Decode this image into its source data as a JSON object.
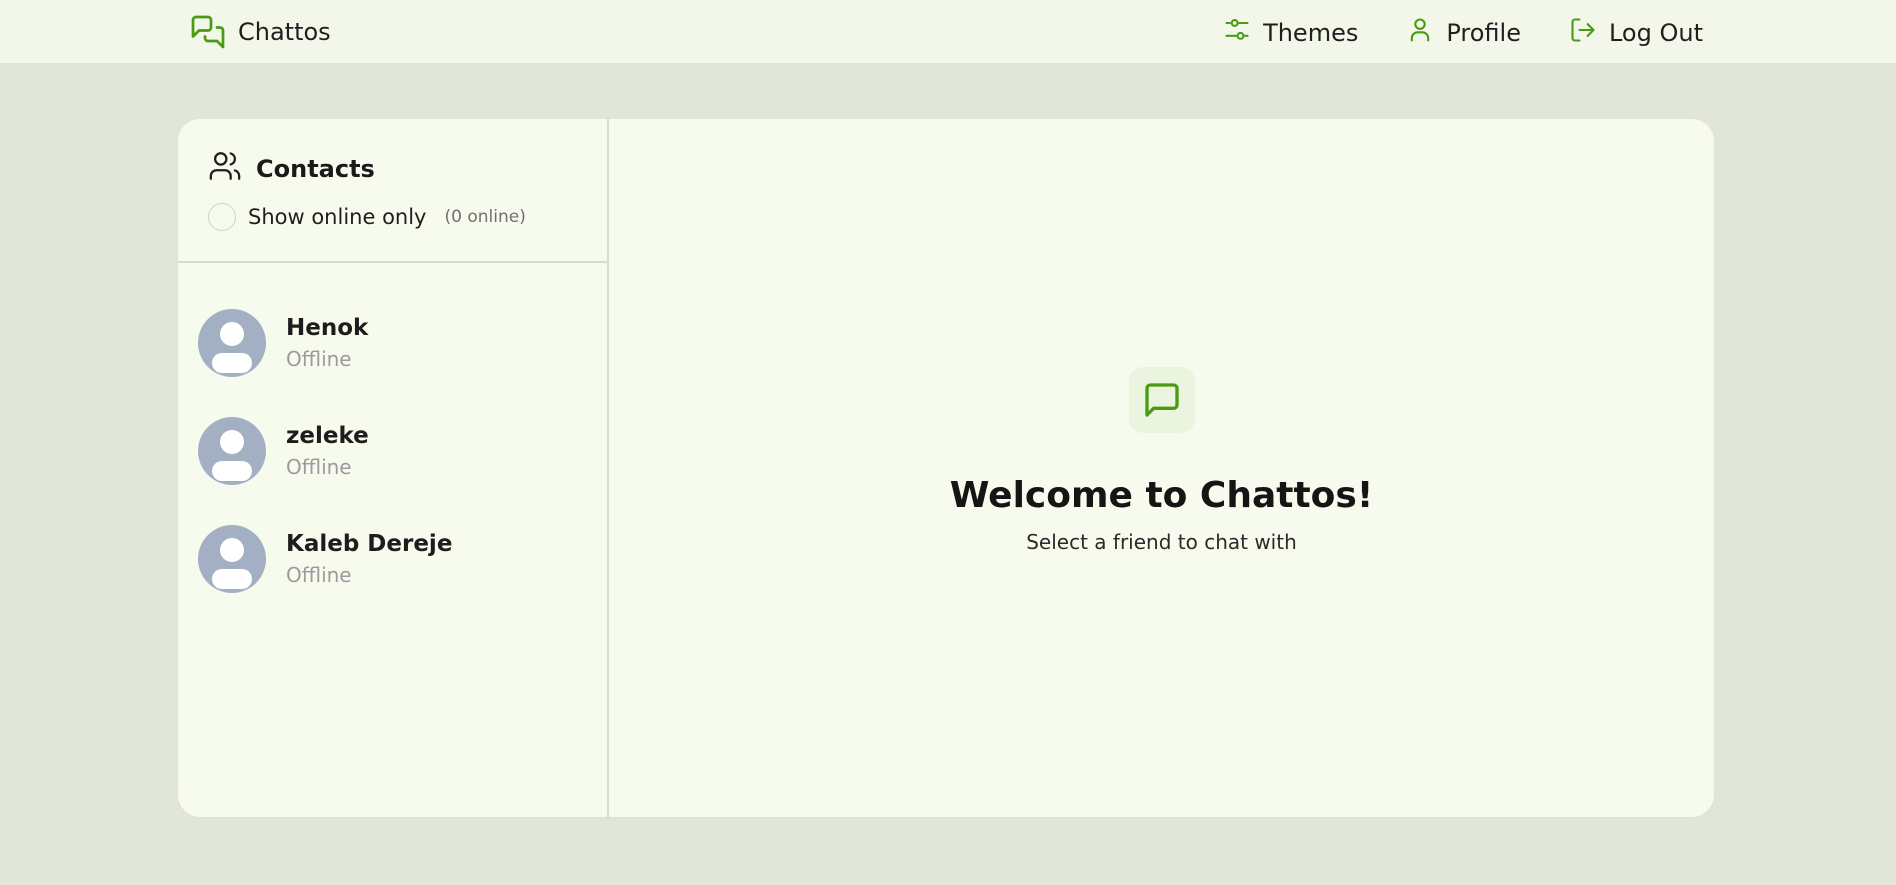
{
  "app": {
    "name": "Chattos",
    "accent": "#4a9a12"
  },
  "nav": {
    "themes_label": "Themes",
    "profile_label": "Profile",
    "logout_label": "Log Out"
  },
  "sidebar": {
    "title": "Contacts",
    "filter_label": "Show online only",
    "online_count": "(0 online)",
    "filter_checked": false,
    "contacts": [
      {
        "name": "Henok",
        "status": "Offline"
      },
      {
        "name": "zeleke",
        "status": "Offline"
      },
      {
        "name": "Kaleb Dereje",
        "status": "Offline"
      }
    ]
  },
  "main": {
    "welcome_title": "Welcome to Chattos!",
    "welcome_subtitle": "Select a friend to chat with"
  },
  "icons": {
    "brand": "chat-bubbles-icon",
    "themes": "sliders-icon",
    "profile": "user-icon",
    "logout": "logout-icon",
    "contacts": "users-icon",
    "welcome": "message-square-icon",
    "avatar": "default-avatar-icon"
  }
}
